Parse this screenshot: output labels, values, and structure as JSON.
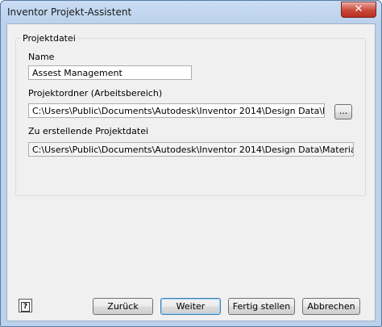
{
  "window": {
    "title": "Inventor Projekt-Assistent",
    "close_glyph": "✕"
  },
  "group": {
    "title": "Projektdatei"
  },
  "name": {
    "label": "Name",
    "value": "Assest Management"
  },
  "project_folder": {
    "label": "Projektordner (Arbeitsbereich)",
    "value": "C:\\Users\\Public\\Documents\\Autodesk\\Inventor 2014\\Design Data\\Materials",
    "browse_label": "..."
  },
  "project_file": {
    "label": "Zu erstellende Projektdatei",
    "value": "C:\\Users\\Public\\Documents\\Autodesk\\Inventor 2014\\Design Data\\Materials\\Assest Management.ipj"
  },
  "buttons": {
    "back": "Zurück",
    "next": "Weiter",
    "finish": "Fertig stellen",
    "cancel": "Abbrechen"
  },
  "help": {
    "icon": "help-icon",
    "glyph": "?"
  }
}
